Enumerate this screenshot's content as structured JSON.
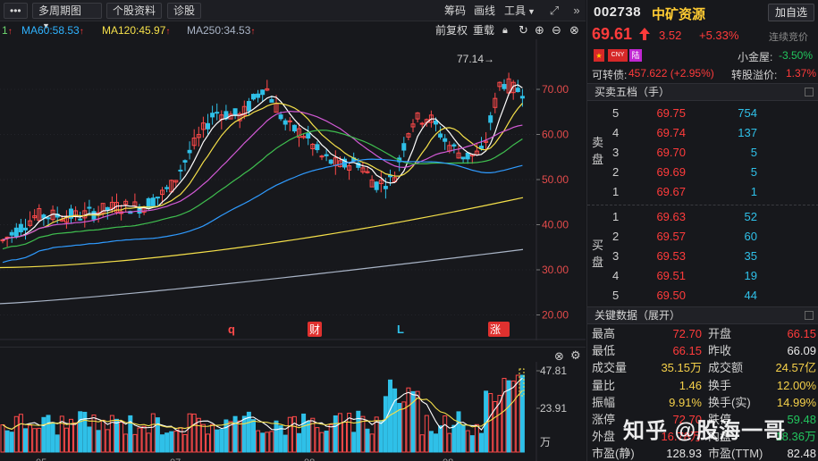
{
  "toolbar": {
    "menu_label": "•••",
    "period_label": "多周期图",
    "stock_info_label": "个股资料",
    "diagnose_label": "诊股",
    "chips_label": "筹码",
    "draw_label": "画线",
    "tools_label": "工具"
  },
  "ma_row": {
    "ma_partial": "1",
    "ma60": "MA60:58.53",
    "ma120": "MA120:45.97",
    "ma250": "MA250:34.53",
    "restore_label": "前复权",
    "overlay_label": "重载"
  },
  "kchart": {
    "high_label": "77.14→",
    "event_markers": [
      "q",
      "财",
      "L",
      "涨"
    ],
    "price_ticks": [
      "70.00",
      "60.00",
      "50.00",
      "40.00",
      "30.00",
      "20.00"
    ]
  },
  "volume": {
    "ticks": [
      "47.81",
      "23.91",
      "万"
    ],
    "months": [
      "05",
      "07",
      "08",
      "08"
    ]
  },
  "quote": {
    "code": "002738",
    "name": "中矿资源",
    "add_label": "加自选",
    "price": "69.61",
    "change": "3.52",
    "change_pct": "+5.33%",
    "auction_label": "连续竞价",
    "flags": [
      "CNY",
      "陆"
    ],
    "small_gold_label": "小金屋:",
    "small_gold_value": "-3.50%",
    "convertible_label": "可转债:",
    "convertible_value": "457.622 (+2.95%)",
    "premium_label": "转股溢价:",
    "premium_value": "1.37%"
  },
  "orderbook": {
    "title": "买卖五档（手）",
    "sell_side_label": [
      "卖",
      "盘"
    ],
    "buy_side_label": [
      "买",
      "盘"
    ],
    "asks": [
      {
        "level": "5",
        "price": "69.75",
        "volume": "754"
      },
      {
        "level": "4",
        "price": "69.74",
        "volume": "137"
      },
      {
        "level": "3",
        "price": "69.70",
        "volume": "5"
      },
      {
        "level": "2",
        "price": "69.69",
        "volume": "5"
      },
      {
        "level": "1",
        "price": "69.67",
        "volume": "1"
      }
    ],
    "bids": [
      {
        "level": "1",
        "price": "69.63",
        "volume": "52"
      },
      {
        "level": "2",
        "price": "69.57",
        "volume": "60"
      },
      {
        "level": "3",
        "price": "69.53",
        "volume": "35"
      },
      {
        "level": "4",
        "price": "69.51",
        "volume": "19"
      },
      {
        "level": "5",
        "price": "69.50",
        "volume": "44"
      }
    ]
  },
  "key_data": {
    "title": "关键数据（展开）",
    "rows": [
      {
        "l1": "最高",
        "v1": "72.70",
        "c1": "red",
        "l2": "开盘",
        "v2": "66.15",
        "c2": "red"
      },
      {
        "l1": "最低",
        "v1": "66.15",
        "c1": "red",
        "l2": "昨收",
        "v2": "66.09",
        "c2": "white"
      },
      {
        "l1": "成交量",
        "v1": "35.15万",
        "c1": "yellow",
        "l2": "成交额",
        "v2": "24.57亿",
        "c2": "yellow"
      },
      {
        "l1": "量比",
        "v1": "1.46",
        "c1": "yellow",
        "l2": "换手",
        "v2": "12.00%",
        "c2": "yellow"
      },
      {
        "l1": "振幅",
        "v1": "9.91%",
        "c1": "yellow",
        "l2": "换手(实)",
        "v2": "14.99%",
        "c2": "yellow"
      },
      {
        "l1": "涨停",
        "v1": "72.70",
        "c1": "red",
        "l2": "跌停",
        "v2": "59.48",
        "c2": "green"
      },
      {
        "l1": "外盘",
        "v1": "16.78万",
        "c1": "red",
        "l2": "内盘",
        "v2": "18.36万",
        "c2": "green"
      },
      {
        "l1": "市盈(静)",
        "v1": "128.93",
        "c1": "white",
        "l2": "市盈(TTM)",
        "v2": "82.48",
        "c2": "white"
      }
    ]
  },
  "watermark": "知乎 @股海一哥"
}
